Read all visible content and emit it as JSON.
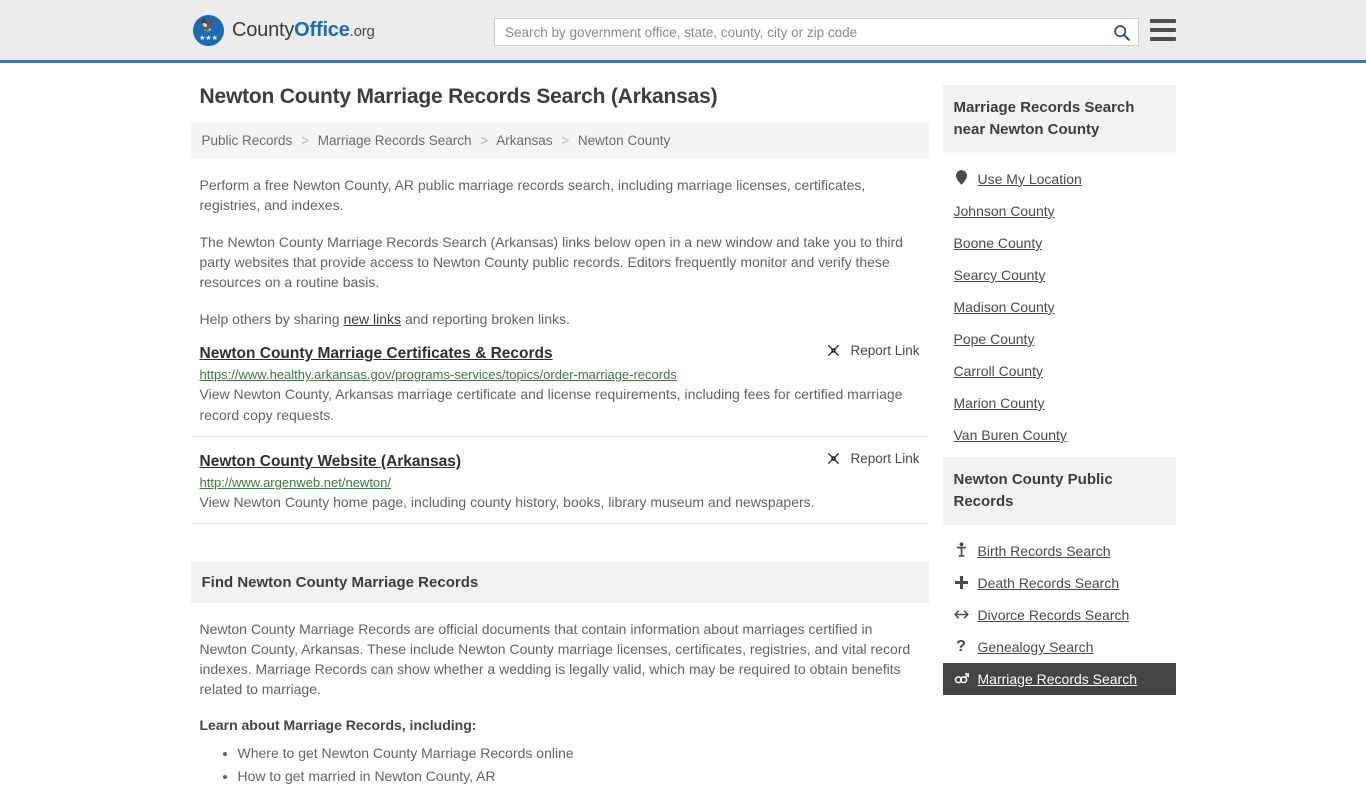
{
  "header": {
    "logo": {
      "text_part1": "County",
      "text_part2": "Office",
      "text_part3": ".org",
      "icon": "eagle-seal-icon"
    },
    "search": {
      "placeholder": "Search by government office, state, county, city or zip code",
      "value": "",
      "button_icon": "search-icon"
    },
    "menu_icon": "hamburger-menu-icon"
  },
  "main": {
    "title": "Newton County Marriage Records Search (Arkansas)",
    "breadcrumb": [
      "Public Records",
      "Marriage Records Search",
      "Arkansas",
      "Newton County"
    ],
    "breadcrumb_separator": ">",
    "intro": {
      "p1": "Perform a free Newton County, AR public marriage records search, including marriage licenses, certificates, registries, and indexes.",
      "p2": "The Newton County Marriage Records Search (Arkansas) links below open in a new window and take you to third party websites that provide access to Newton County public records. Editors frequently monitor and verify these resources on a routine basis.",
      "p3_before": "Help others by sharing ",
      "p3_link": "new links",
      "p3_after": " and reporting broken links."
    },
    "report_link_label": "Report Link",
    "report_link_icon": "broken-link-icon",
    "results": [
      {
        "title": "Newton County Marriage Certificates & Records",
        "url": "https://www.healthy.arkansas.gov/programs-services/topics/order-marriage-records",
        "description": "View Newton County, Arkansas marriage certificate and license requirements, including fees for certified marriage record copy requests."
      },
      {
        "title": "Newton County Website (Arkansas)",
        "url": "http://www.argenweb.net/newton/",
        "description": "View Newton County home page, including county history, books, library museum and newspapers."
      }
    ],
    "section": {
      "heading": "Find Newton County Marriage Records",
      "paragraph": "Newton County Marriage Records are official documents that contain information about marriages certified in Newton County, Arkansas. These include Newton County marriage licenses, certificates, registries, and vital record indexes. Marriage Records can show whether a wedding is legally valid, which may be required to obtain benefits related to marriage.",
      "learn_heading": "Learn about Marriage Records, including:",
      "learn_items": [
        "Where to get Newton County Marriage Records online",
        "How to get married in Newton County, AR"
      ]
    }
  },
  "sidebar": {
    "nearby": {
      "heading": "Marriage Records Search near Newton County",
      "items": [
        {
          "label": "Use My Location",
          "icon": "map-pin-icon",
          "glyph": "●",
          "active": false
        },
        {
          "label": "Johnson County",
          "icon": "",
          "glyph": "",
          "active": false
        },
        {
          "label": "Boone County",
          "icon": "",
          "glyph": "",
          "active": false
        },
        {
          "label": "Searcy County",
          "icon": "",
          "glyph": "",
          "active": false
        },
        {
          "label": "Madison County",
          "icon": "",
          "glyph": "",
          "active": false
        },
        {
          "label": "Pope County",
          "icon": "",
          "glyph": "",
          "active": false
        },
        {
          "label": "Carroll County",
          "icon": "",
          "glyph": "",
          "active": false
        },
        {
          "label": "Marion County",
          "icon": "",
          "glyph": "",
          "active": false
        },
        {
          "label": "Van Buren County",
          "icon": "",
          "glyph": "",
          "active": false
        }
      ]
    },
    "public_records": {
      "heading": "Newton County Public Records",
      "items": [
        {
          "label": "Birth Records Search",
          "icon": "baby-icon",
          "glyph": "Ɣ",
          "active": false
        },
        {
          "label": "Death Records Search",
          "icon": "cross-plus-icon",
          "glyph": "✚",
          "active": false
        },
        {
          "label": "Divorce Records Search",
          "icon": "left-right-arrow-icon",
          "glyph": "↔",
          "active": false
        },
        {
          "label": "Genealogy Search",
          "icon": "question-mark-icon",
          "glyph": "?",
          "active": false
        },
        {
          "label": "Marriage Records Search",
          "icon": "gender-symbols-icon",
          "glyph": "⚥",
          "active": true
        }
      ]
    }
  },
  "colors": {
    "header_bg": "#ececec",
    "header_border": "#3a76ab",
    "brand_blue": "#1b6cb5",
    "url_green": "#3f7a3f",
    "panel_head_bg": "#f2f2f2",
    "active_bg": "#444444"
  }
}
